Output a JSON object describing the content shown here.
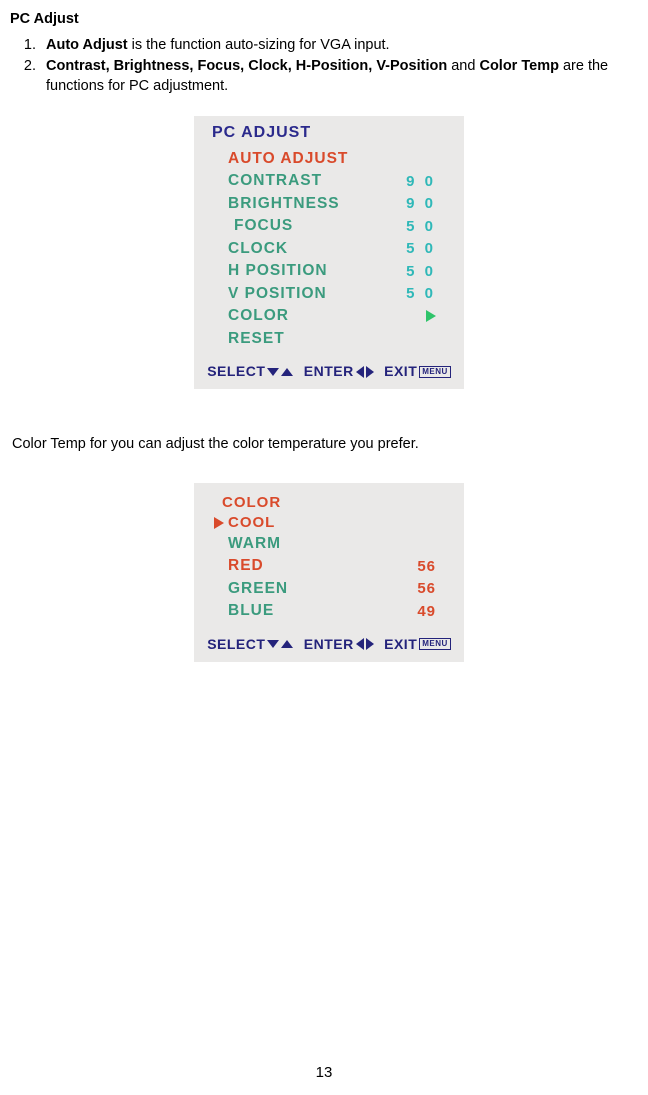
{
  "section_title": "PC Adjust",
  "list": {
    "item1_bold": "Auto Adjust",
    "item1_tail": " is the function auto-sizing for VGA input.",
    "item2_bold": "Contrast, Brightness, Focus, Clock, H-Position, V-Position",
    "item2_mid": " and ",
    "item2_bold2": "Color Temp",
    "item2_tail": " are the functions for PC adjustment."
  },
  "osd1": {
    "title": "PC ADJUST",
    "auto": "AUTO ADJUST",
    "rows": [
      {
        "label": "CONTRAST",
        "value": "9 0"
      },
      {
        "label": "BRIGHTNESS",
        "value": "9 0"
      },
      {
        "label": "FOCUS",
        "value": "5 0"
      },
      {
        "label": "CLOCK",
        "value": "5 0"
      },
      {
        "label": "H POSITION",
        "value": "5 0"
      },
      {
        "label": "V POSITION",
        "value": "5 0"
      }
    ],
    "color": "COLOR",
    "reset": "RESET"
  },
  "footer": {
    "select": "SELECT",
    "enter": "ENTER",
    "exit": "EXIT",
    "menu": "MENU"
  },
  "para2": "Color Temp for you can adjust the color temperature you prefer.",
  "osd2": {
    "title": "COLOR",
    "cool": "COOL",
    "warm": "WARM",
    "rows": [
      {
        "label": "RED",
        "value": "56"
      },
      {
        "label": "GREEN",
        "value": "56"
      },
      {
        "label": "BLUE",
        "value": "49"
      }
    ]
  },
  "page": "13"
}
